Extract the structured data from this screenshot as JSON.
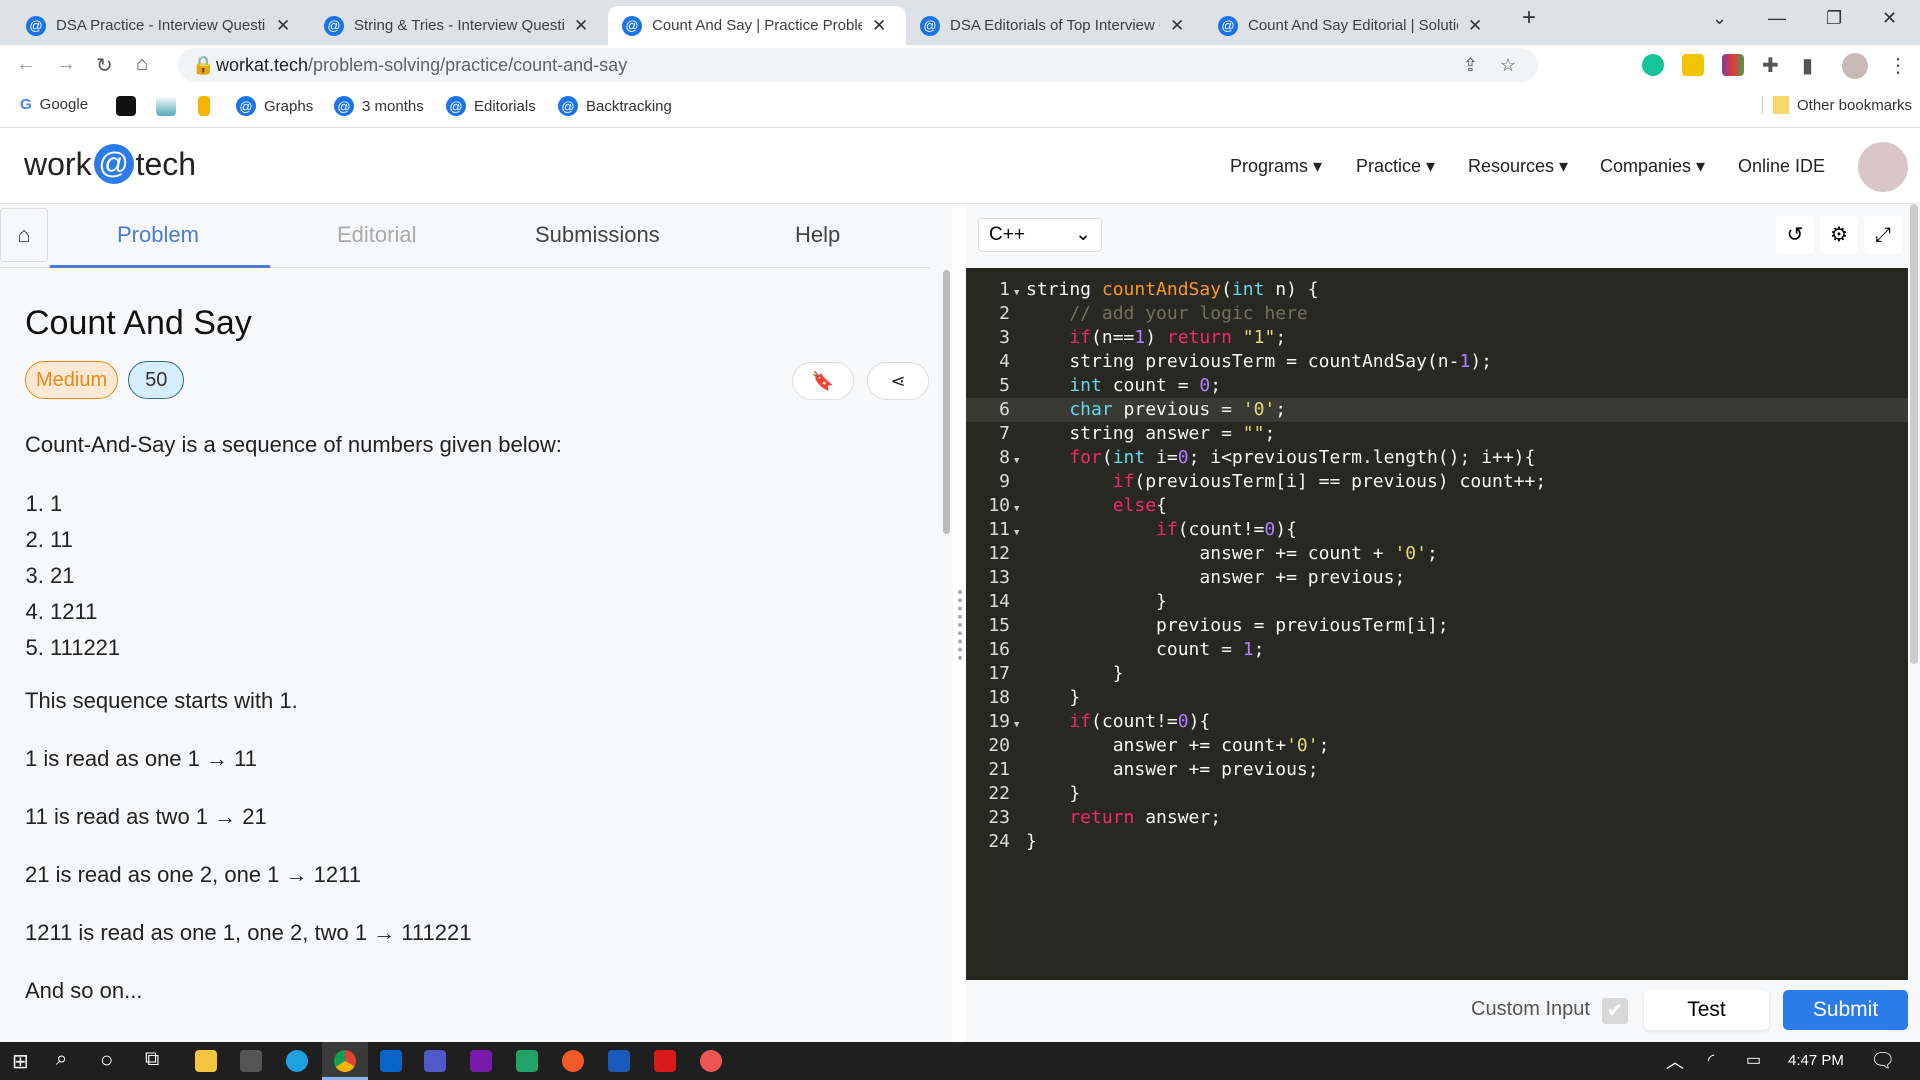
{
  "browser": {
    "tabs": [
      {
        "title": "DSA Practice - Interview Questions",
        "active": false
      },
      {
        "title": "String & Tries - Interview Questions",
        "active": false
      },
      {
        "title": "Count And Say | Practice Problem",
        "active": true
      },
      {
        "title": "DSA Editorials of Top Interview Questions",
        "active": false
      },
      {
        "title": "Count And Say Editorial | Solution",
        "active": false
      }
    ],
    "url_domain": "workat.tech",
    "url_path": "/problem-solving/practice/count-and-say",
    "bookmarks": [
      "Google",
      "Graphs",
      "3 months",
      "Editorials",
      "Backtracking"
    ],
    "other_bookmarks": "Other bookmarks"
  },
  "site": {
    "logo": {
      "pre": "work",
      "at": "@",
      "post": "tech"
    },
    "menu": [
      "Programs",
      "Practice",
      "Resources",
      "Companies",
      "Online IDE"
    ]
  },
  "left": {
    "tabs": [
      "Problem",
      "Editorial",
      "Submissions",
      "Help"
    ],
    "title": "Count And Say",
    "difficulty": "Medium",
    "points": "50",
    "intro": "Count-And-Say is a sequence of numbers given below:",
    "sequence": [
      "1",
      "11",
      "21",
      "1211",
      "111221"
    ],
    "paragraphs": [
      "This sequence starts with 1.",
      "1 is read as one 1 → 11",
      "11 is read as two 1 → 21",
      "21 is read as one 2, one 1 → 1211",
      "1211 is read as one 1, one 2, two 1 → 111221",
      "And so on..."
    ]
  },
  "editor": {
    "language": "C++",
    "highlighted_line": 6,
    "lines": [
      [
        [
          "p",
          "string "
        ],
        [
          "fn",
          "countAndSay"
        ],
        [
          "p",
          "("
        ],
        [
          "ty",
          "int"
        ],
        [
          "p",
          " n) {"
        ]
      ],
      [
        [
          "c",
          "    // add your logic here"
        ]
      ],
      [
        [
          "k",
          "    if"
        ],
        [
          "p",
          "(n=="
        ],
        [
          "n",
          "1"
        ],
        [
          "p",
          ") "
        ],
        [
          "k",
          "return"
        ],
        [
          "p",
          " "
        ],
        [
          "s",
          "\"1\""
        ],
        [
          "p",
          ";"
        ]
      ],
      [
        [
          "p",
          "    string previousTerm = countAndSay(n-"
        ],
        [
          "n",
          "1"
        ],
        [
          "p",
          ");"
        ]
      ],
      [
        [
          "ty",
          "    int"
        ],
        [
          "p",
          " count = "
        ],
        [
          "n",
          "0"
        ],
        [
          "p",
          ";"
        ]
      ],
      [
        [
          "ty",
          "    char"
        ],
        [
          "p",
          " previous = "
        ],
        [
          "s",
          "'0'"
        ],
        [
          "p",
          ";"
        ]
      ],
      [
        [
          "p",
          "    string answer = "
        ],
        [
          "s",
          "\"\""
        ],
        [
          "p",
          ";"
        ]
      ],
      [
        [
          "k",
          "    for"
        ],
        [
          "p",
          "("
        ],
        [
          "ty",
          "int"
        ],
        [
          "p",
          " i="
        ],
        [
          "n",
          "0"
        ],
        [
          "p",
          "; i<previousTerm.length(); i++){"
        ]
      ],
      [
        [
          "k",
          "        if"
        ],
        [
          "p",
          "(previousTerm[i] == previous) count++;"
        ]
      ],
      [
        [
          "k",
          "        else"
        ],
        [
          "p",
          "{"
        ]
      ],
      [
        [
          "k",
          "            if"
        ],
        [
          "p",
          "(count!="
        ],
        [
          "n",
          "0"
        ],
        [
          "p",
          "){"
        ]
      ],
      [
        [
          "p",
          "                answer += count + "
        ],
        [
          "s",
          "'0'"
        ],
        [
          "p",
          ";"
        ]
      ],
      [
        [
          "p",
          "                answer += previous;"
        ]
      ],
      [
        [
          "p",
          "            }"
        ]
      ],
      [
        [
          "p",
          "            previous = previousTerm[i];"
        ]
      ],
      [
        [
          "p",
          "            count = "
        ],
        [
          "n",
          "1"
        ],
        [
          "p",
          ";"
        ]
      ],
      [
        [
          "p",
          "        }"
        ]
      ],
      [
        [
          "p",
          "    }"
        ]
      ],
      [
        [
          "k",
          "    if"
        ],
        [
          "p",
          "(count!="
        ],
        [
          "n",
          "0"
        ],
        [
          "p",
          "){"
        ]
      ],
      [
        [
          "p",
          "        answer += count+"
        ],
        [
          "s",
          "'0'"
        ],
        [
          "p",
          ";"
        ]
      ],
      [
        [
          "p",
          "        answer += previous;"
        ]
      ],
      [
        [
          "p",
          "    }"
        ]
      ],
      [
        [
          "k",
          "    return"
        ],
        [
          "p",
          " answer;"
        ]
      ],
      [
        [
          "p",
          "}"
        ]
      ]
    ],
    "foldable": [
      1,
      8,
      10,
      11,
      19
    ]
  },
  "footer": {
    "custom_input": "Custom Input",
    "custom_input_checked": true,
    "test": "Test",
    "submit": "Submit"
  },
  "taskbar": {
    "time": "4:47 PM"
  },
  "colors": {
    "accent": "#2b7bea",
    "editor_bg": "#272822",
    "medium": "#e88a1a"
  }
}
